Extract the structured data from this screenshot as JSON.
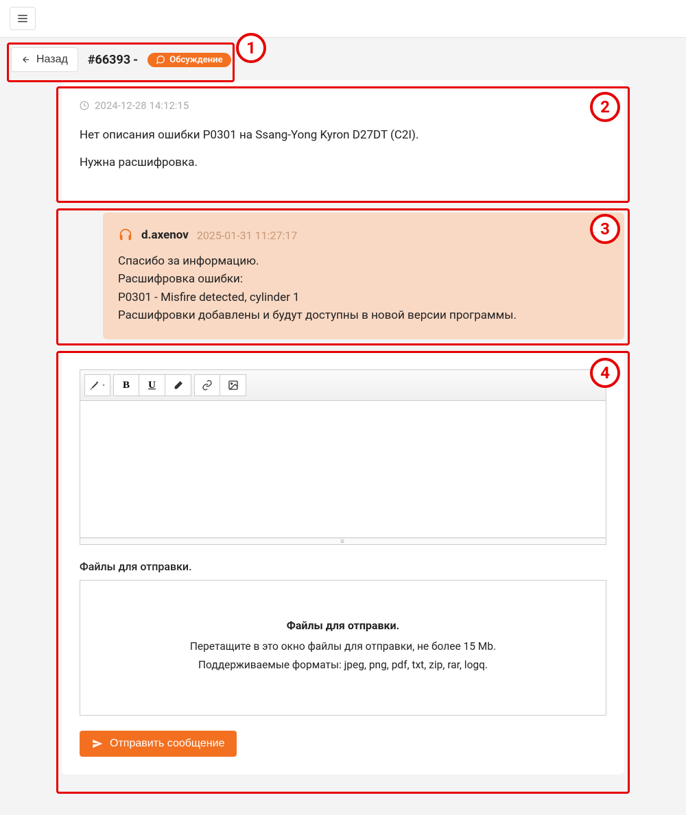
{
  "header": {
    "back_label": "Назад",
    "ticket_id": "#66393",
    "dash": "-",
    "status_label": "Обсуждение"
  },
  "original_post": {
    "timestamp": "2024-12-28 14:12:15",
    "line1": "Нет описания ошибки P0301 на Ssang-Yong Kyron D27DT (C2I).",
    "line2": "Нужна расшифровка."
  },
  "reply": {
    "author": "d.axenov",
    "timestamp": "2025-01-31 11:27:17",
    "line1": "Спасибо за информацию.",
    "line2": "Расшифровка ошибки:",
    "line3": "P0301 - Misfire detected, cylinder 1",
    "line4": "Расшифровки добавлены и будут доступны в новой версии программы."
  },
  "composer": {
    "files_label": "Файлы для отправки.",
    "dropzone_title": "Файлы для отправки.",
    "dropzone_line1": "Перетащите в это окно файлы для отправки, не более 15 Mb.",
    "dropzone_line2": "Поддерживаемые форматы: jpeg, png, pdf, txt, zip, rar, logq.",
    "send_label": "Отправить сообщение"
  },
  "annotations": {
    "a1": "1",
    "a2": "2",
    "a3": "3",
    "a4": "4"
  }
}
